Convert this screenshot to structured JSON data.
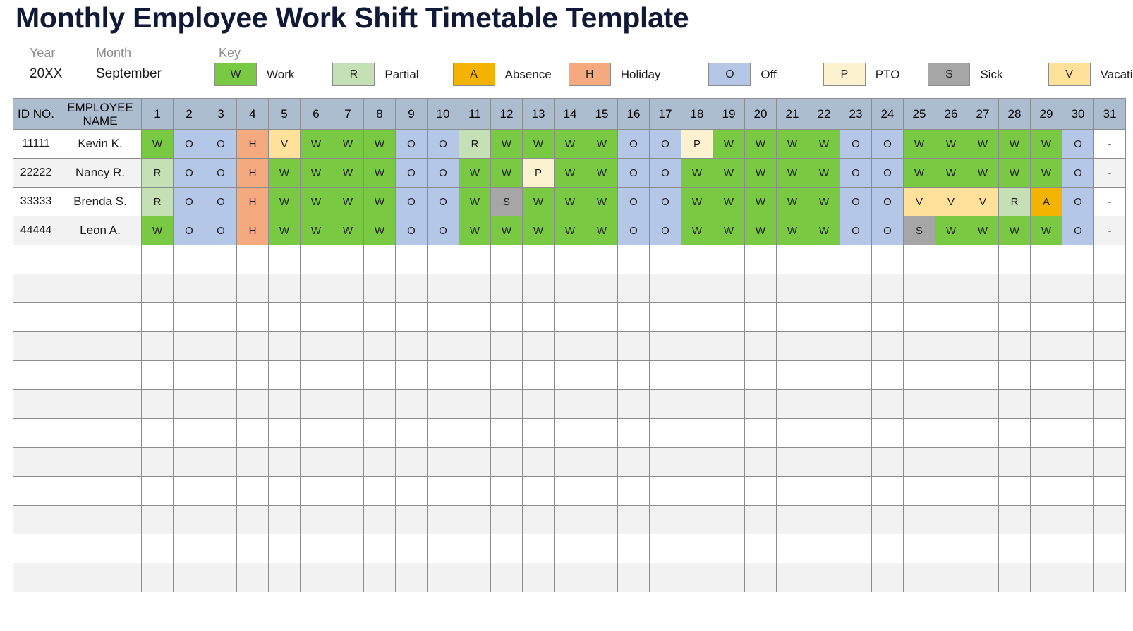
{
  "title": "Monthly Employee Work Shift Timetable Template",
  "meta": {
    "year_label": "Year",
    "year_value": "20XX",
    "month_label": "Month",
    "month_value": "September"
  },
  "legend": {
    "title": "Key",
    "items": [
      {
        "code": "W",
        "label": "Work",
        "color": "#7ac943"
      },
      {
        "code": "R",
        "label": "Partial",
        "color": "#c5e0b4"
      },
      {
        "code": "A",
        "label": "Absence",
        "color": "#f5b301"
      },
      {
        "code": "H",
        "label": "Holiday",
        "color": "#f4a97e"
      },
      {
        "code": "O",
        "label": "Off",
        "color": "#b4c7e7"
      },
      {
        "code": "P",
        "label": "PTO",
        "color": "#fdf2cf"
      },
      {
        "code": "S",
        "label": "Sick",
        "color": "#a6a6a6"
      },
      {
        "code": "V",
        "label": "Vacation",
        "color": "#ffe199"
      }
    ]
  },
  "table": {
    "headers": {
      "id": "ID NO.",
      "name": "EMPLOYEE NAME",
      "days": [
        "1",
        "2",
        "3",
        "4",
        "5",
        "6",
        "7",
        "8",
        "9",
        "10",
        "11",
        "12",
        "13",
        "14",
        "15",
        "16",
        "17",
        "18",
        "19",
        "20",
        "21",
        "22",
        "23",
        "24",
        "25",
        "26",
        "27",
        "28",
        "29",
        "30",
        "31"
      ]
    },
    "status_colors": {
      "W": "#7ac943",
      "R": "#c5e0b4",
      "A": "#f5b301",
      "H": "#f4a97e",
      "O": "#b4c7e7",
      "P": "#fdf2cf",
      "S": "#a6a6a6",
      "V": "#ffe199",
      "-": ""
    },
    "rows": [
      {
        "id": "11111",
        "name": "Kevin K.",
        "days": [
          "W",
          "O",
          "O",
          "H",
          "V",
          "W",
          "W",
          "W",
          "O",
          "O",
          "R",
          "W",
          "W",
          "W",
          "W",
          "O",
          "O",
          "P",
          "W",
          "W",
          "W",
          "W",
          "O",
          "O",
          "W",
          "W",
          "W",
          "W",
          "W",
          "O",
          "-"
        ]
      },
      {
        "id": "22222",
        "name": "Nancy R.",
        "days": [
          "R",
          "O",
          "O",
          "H",
          "W",
          "W",
          "W",
          "W",
          "O",
          "O",
          "W",
          "W",
          "P",
          "W",
          "W",
          "O",
          "O",
          "W",
          "W",
          "W",
          "W",
          "W",
          "O",
          "O",
          "W",
          "W",
          "W",
          "W",
          "W",
          "O",
          "-"
        ]
      },
      {
        "id": "33333",
        "name": "Brenda S.",
        "days": [
          "R",
          "O",
          "O",
          "H",
          "W",
          "W",
          "W",
          "W",
          "O",
          "O",
          "W",
          "S",
          "W",
          "W",
          "W",
          "O",
          "O",
          "W",
          "W",
          "W",
          "W",
          "W",
          "O",
          "O",
          "V",
          "V",
          "V",
          "R",
          "A",
          "O",
          "-"
        ]
      },
      {
        "id": "44444",
        "name": "Leon A.",
        "days": [
          "W",
          "O",
          "O",
          "H",
          "W",
          "W",
          "W",
          "W",
          "O",
          "O",
          "W",
          "W",
          "W",
          "W",
          "W",
          "O",
          "O",
          "W",
          "W",
          "W",
          "W",
          "W",
          "O",
          "O",
          "S",
          "W",
          "W",
          "W",
          "W",
          "O",
          "-"
        ]
      }
    ],
    "empty_row_count": 12
  }
}
